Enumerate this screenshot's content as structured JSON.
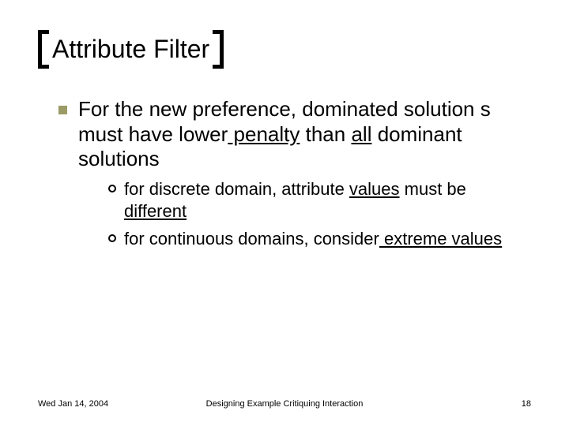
{
  "title": "Attribute Filter",
  "lvl1": {
    "pre": "For the new preference, dominated solution s must have lower",
    "u1": " penalty",
    "mid": " than ",
    "u2": "all",
    "post": " dominant solutions"
  },
  "sub1": {
    "pre": "for discrete domain, attribute ",
    "u1": "values",
    "mid": " must be",
    "u2": " different"
  },
  "sub2": {
    "pre": "for continuous domains, consider",
    "u1": " extreme values"
  },
  "footer": {
    "date": "Wed Jan 14, 2004",
    "center": "Designing Example Critiquing Interaction",
    "page": "18"
  }
}
